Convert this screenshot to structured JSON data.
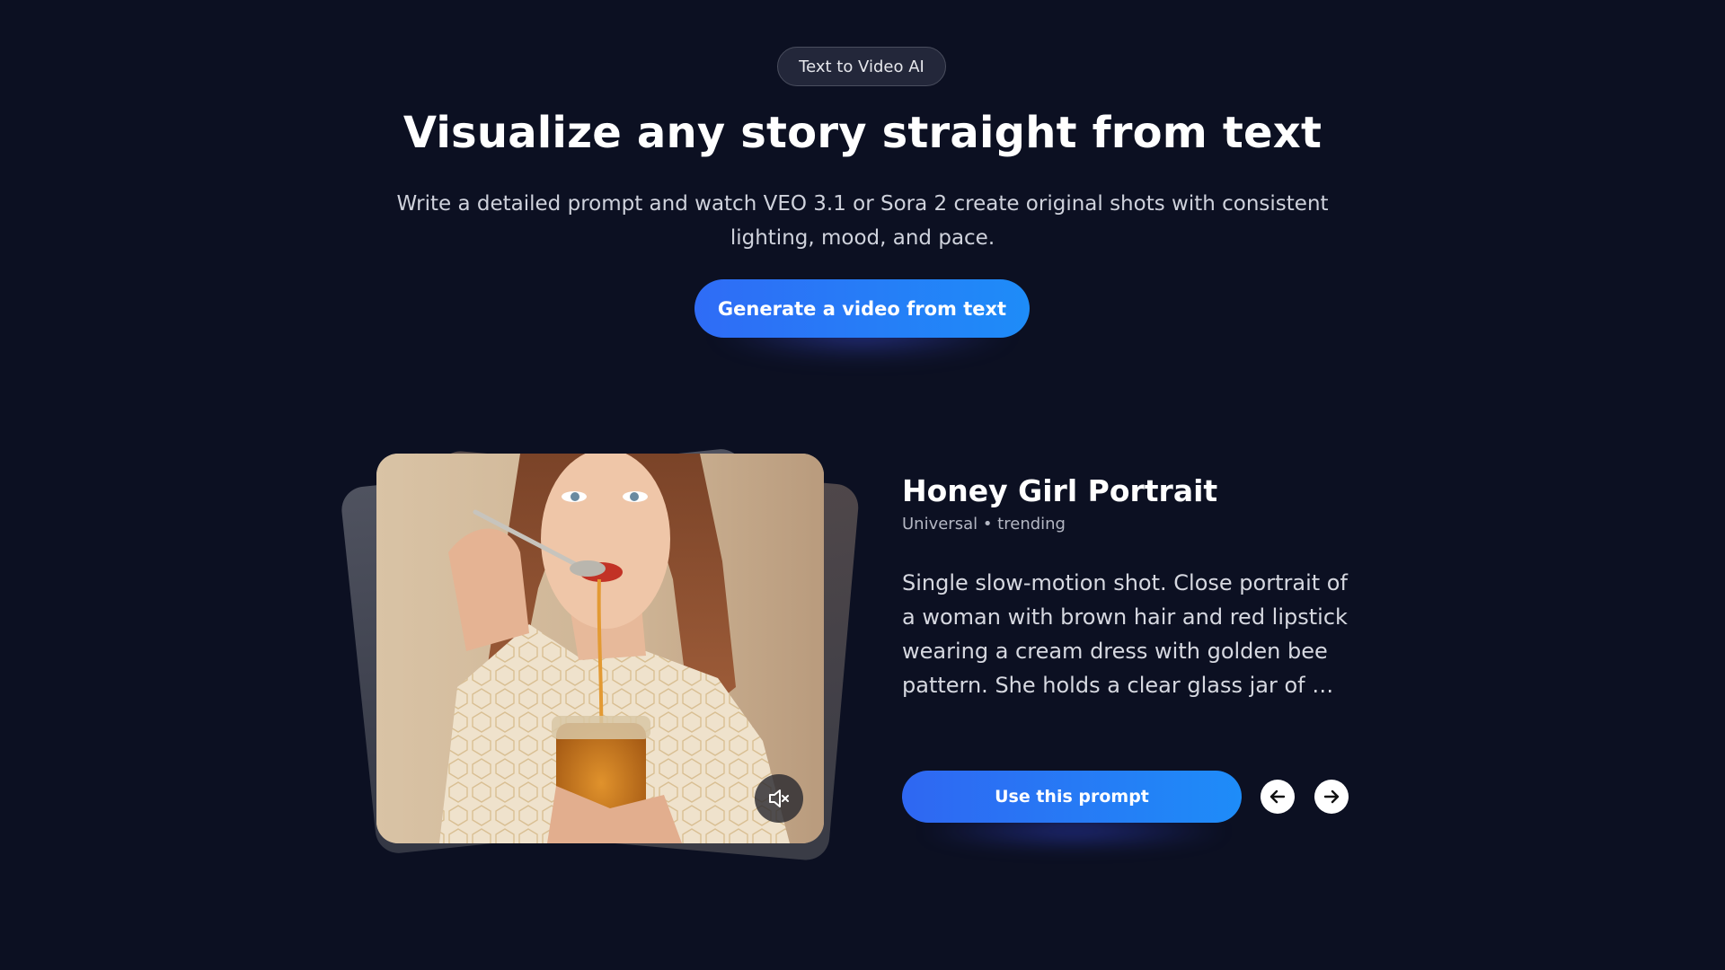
{
  "hero": {
    "badge": "Text to Video AI",
    "title": "Visualize any story straight from text",
    "subtitle": "Write a detailed prompt and watch VEO 3.1 or Sora 2 create original shots with consistent lighting, mood, and pace.",
    "cta_label": "Generate a video from text"
  },
  "showcase": {
    "title": "Honey Girl Portrait",
    "meta": "Universal • trending",
    "description": "Single slow-motion shot. Close portrait of a woman with brown hair and red lipstick wearing a cream dress with golden bee pattern. She holds a clear glass jar of …",
    "use_prompt_label": "Use this prompt",
    "mute_icon": "speaker-muted-icon",
    "prev_icon": "arrow-left-icon",
    "next_icon": "arrow-right-icon"
  },
  "colors": {
    "background": "#0c1022",
    "accent": "#2f6cf6"
  }
}
